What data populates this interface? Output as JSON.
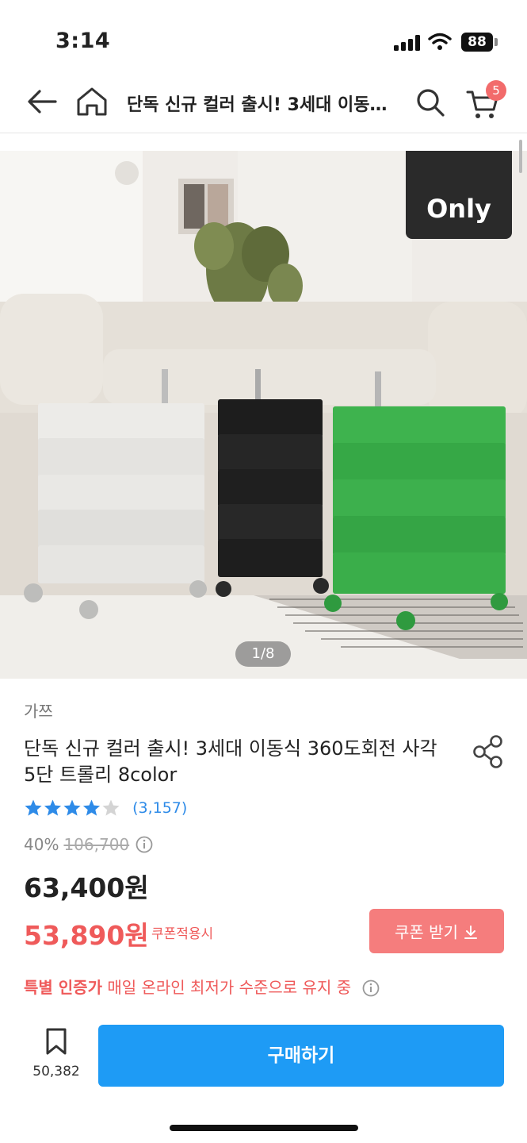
{
  "status_bar": {
    "time": "3:14",
    "battery": "88"
  },
  "nav": {
    "title": "단독 신규 컬러 출시! 3세대 이동식 360도회전 사각 5단 트롤리 8color",
    "cart_count": "5",
    "icons": [
      "back-arrow-icon",
      "home-icon",
      "search-icon",
      "cart-icon"
    ]
  },
  "gallery": {
    "badge": "Only",
    "page_indicator": "1/8",
    "current_page": 1,
    "total_pages": 8
  },
  "product": {
    "brand": "가쯔",
    "title": "단독 신규 컬러 출시! 3세대 이동식 360도회전 사각 5단 트롤리 8color",
    "rating": 4.5,
    "rating_count": "(3,157)",
    "discount_rate": "40%",
    "original_price": "106,700",
    "sale_price": "63,400원",
    "coupon_price": "53,890원",
    "coupon_label": "쿠폰적용시",
    "coupon_button": "쿠폰 받기",
    "notice_strong": "특별 인증가",
    "notice_text": "매일 온라인 최저가 수준으로 유지 중"
  },
  "bottom_bar": {
    "bookmark_count": "50,382",
    "buy_label": "구매하기"
  },
  "colors": {
    "accent_blue": "#1e9bf5",
    "price_red": "#ef5a5a",
    "coupon_button": "#f57d7d",
    "star": "#2e8be8"
  }
}
